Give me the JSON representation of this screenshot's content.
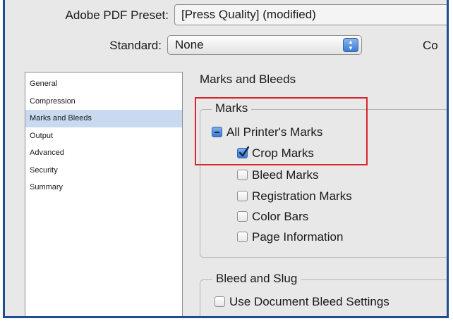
{
  "header": {
    "preset_label": "Adobe PDF Preset:",
    "preset_value": "[Press Quality] (modified)",
    "standard_label": "Standard:",
    "standard_value": "None",
    "compatibility_label": "Co"
  },
  "sidebar": {
    "items": [
      {
        "label": "General",
        "selected": false
      },
      {
        "label": "Compression",
        "selected": false
      },
      {
        "label": "Marks and Bleeds",
        "selected": true
      },
      {
        "label": "Output",
        "selected": false
      },
      {
        "label": "Advanced",
        "selected": false
      },
      {
        "label": "Security",
        "selected": false
      },
      {
        "label": "Summary",
        "selected": false
      }
    ]
  },
  "main": {
    "section_title": "Marks and Bleeds",
    "marks_group": {
      "legend": "Marks",
      "all_printers_marks": {
        "label": "All Printer's Marks",
        "state": "mixed"
      },
      "items": [
        {
          "label": "Crop Marks",
          "checked": true
        },
        {
          "label": "Bleed Marks",
          "checked": false
        },
        {
          "label": "Registration Marks",
          "checked": false
        },
        {
          "label": "Color Bars",
          "checked": false
        },
        {
          "label": "Page Information",
          "checked": false
        }
      ]
    },
    "bleed_group": {
      "legend": "Bleed and Slug",
      "use_document_bleed": {
        "label": "Use Document Bleed Settings",
        "checked": false
      }
    }
  },
  "colors": {
    "frame": "#1f4e8c",
    "highlight": "#d9262c",
    "selection": "#c9d9ef",
    "accent": "#3b7ad4"
  }
}
